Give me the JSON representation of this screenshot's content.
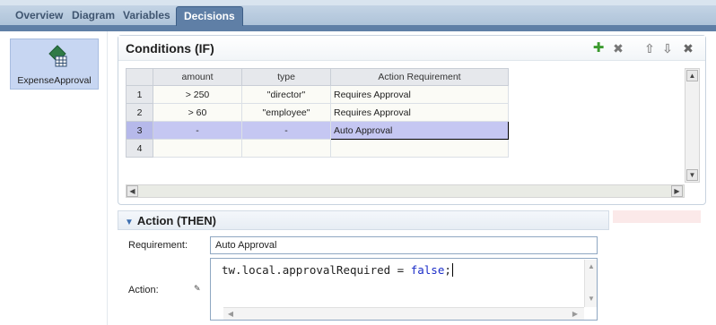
{
  "tabs": [
    {
      "label": "Overview"
    },
    {
      "label": "Diagram"
    },
    {
      "label": "Variables"
    },
    {
      "label": "Decisions"
    }
  ],
  "active_tab": "Decisions",
  "rule": {
    "label": "ExpenseApproval",
    "icon": "rule-table-icon"
  },
  "conditions": {
    "title": "Conditions (IF)",
    "toolbar": {
      "add": "add-row-icon",
      "delete": "delete-row-icon",
      "up": "move-up-icon",
      "down": "move-down-icon",
      "close": "close-icon"
    },
    "columns": [
      "",
      "amount",
      "type",
      "Action Requirement"
    ],
    "rows": [
      {
        "num": "1",
        "amount": "> 250",
        "type": "\"director\"",
        "requirement": "Requires Approval"
      },
      {
        "num": "2",
        "amount": "> 60",
        "type": "\"employee\"",
        "requirement": "Requires Approval"
      },
      {
        "num": "3",
        "amount": "-",
        "type": "-",
        "requirement": "Auto Approval"
      },
      {
        "num": "4",
        "amount": "",
        "type": "",
        "requirement": ""
      }
    ],
    "selected_row": 3
  },
  "action": {
    "title": "Action (THEN)",
    "requirement_label": "Requirement:",
    "requirement_value": "Auto Approval",
    "action_label": "Action:",
    "code_prefix": "tw.local.approvalRequired = ",
    "code_keyword": "false",
    "code_suffix": ";"
  },
  "colors": {
    "tab_active": "#5f7fa6",
    "selected_row": "#c5c7f2",
    "rule_card": "#c7d6f2",
    "add_green": "#3b9a2e",
    "keyword_blue": "#1a2cc8"
  }
}
